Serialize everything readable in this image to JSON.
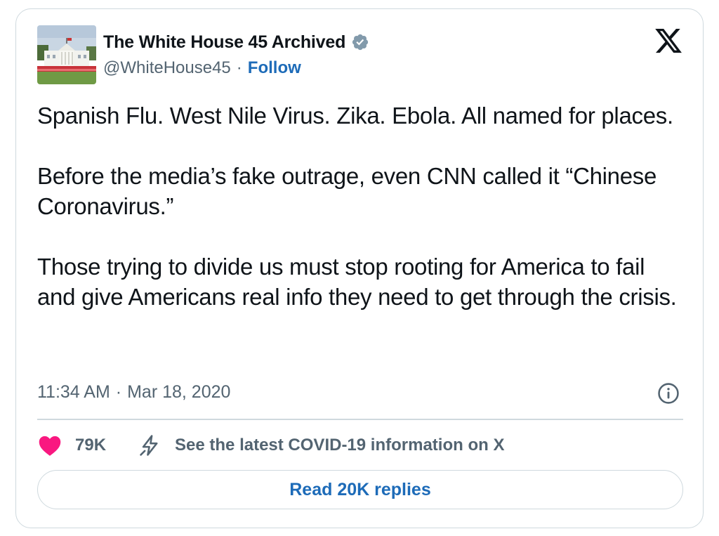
{
  "tweet": {
    "author": {
      "display_name": "The White House 45 Archived",
      "handle": "@WhiteHouse45",
      "verified": true,
      "avatar_icon": "white-house-photo"
    },
    "follow_label": "Follow",
    "separator": "·",
    "paragraphs": [
      "Spanish Flu. West Nile Virus. Zika. Ebola. All named for places.",
      "Before the media’s fake outrage, even CNN called it “Chinese Coronavirus.”",
      "Those trying to divide us must stop rooting for America to fail and give Americans real info they need to get through the crisis."
    ],
    "time": "11:34 AM",
    "date": "Mar 18, 2020",
    "likes": "79K",
    "info_banner": "See the latest COVID-19 information on X",
    "replies_button": "Read 20K replies"
  },
  "icons": {
    "brand": "x-logo",
    "verified": "verified-badge-icon",
    "info": "info-icon",
    "like": "heart-icon",
    "covid": "lightning-bolt-icon"
  },
  "colors": {
    "accent": "#1d6bb8",
    "like": "#f91880",
    "secondary_text": "#536471",
    "border": "#cfd9de"
  }
}
